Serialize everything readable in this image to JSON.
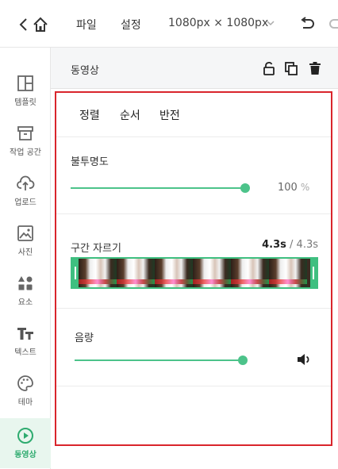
{
  "topbar": {
    "menu_file": "파일",
    "menu_settings": "설정",
    "canvas_size": "1080px × 1080px"
  },
  "sidebar": {
    "items": [
      {
        "label": "템플릿",
        "icon": "template-icon"
      },
      {
        "label": "작업 공간",
        "icon": "workspace-icon"
      },
      {
        "label": "업로드",
        "icon": "upload-icon"
      },
      {
        "label": "사진",
        "icon": "photo-icon"
      },
      {
        "label": "요소",
        "icon": "elements-icon"
      },
      {
        "label": "텍스트",
        "icon": "text-icon"
      },
      {
        "label": "테마",
        "icon": "palette-icon"
      },
      {
        "label": "동영상",
        "icon": "play-icon",
        "active": true
      }
    ]
  },
  "panel": {
    "title": "동영상",
    "tabs": [
      "정렬",
      "순서",
      "반전"
    ],
    "opacity": {
      "label": "불투명도",
      "value": "100",
      "unit": "%",
      "level": 1.0
    },
    "trim": {
      "label": "구간 자르기",
      "current": "4.3s",
      "separator": " / ",
      "total": "4.3s"
    },
    "volume": {
      "label": "음량",
      "level": 1.0
    }
  },
  "colors": {
    "accent": "#4cc38a",
    "highlight_border": "#d9252c",
    "active_bg": "#e8f6ee"
  }
}
